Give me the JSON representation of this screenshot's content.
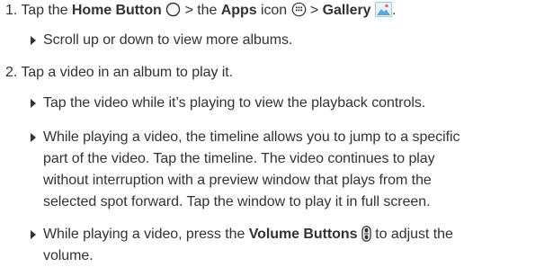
{
  "steps": [
    {
      "num": "1.",
      "parts": {
        "t1": "Tap the ",
        "home_button": "Home Button",
        "t2": " > the ",
        "apps": "Apps",
        "t3": " icon ",
        "t4": " > ",
        "gallery": "Gallery",
        "t5": "."
      },
      "icons": [
        "home-circle-icon",
        "apps-grid-icon",
        "gallery-icon"
      ],
      "bullets": [
        {
          "lines": [
            "Scroll up or down to view more albums."
          ]
        }
      ]
    },
    {
      "num": "2.",
      "text": "Tap a video in an album to play it.",
      "bullets": [
        {
          "lines": [
            "Tap the video while it’s playing to view the playback controls."
          ]
        },
        {
          "lines": [
            "While playing a video, the timeline allows you to jump to a specific",
            "part of the video. Tap the timeline. The video continues to play",
            "without interruption with a preview window that plays from the",
            "selected spot forward. Tap the window to play it in full screen."
          ]
        },
        {
          "pre": "While playing a video, press the ",
          "bold": "Volume Buttons",
          "post": " to adjust the",
          "line2": "volume.",
          "icon": "volume-buttons-icon"
        }
      ]
    }
  ],
  "colors": {
    "text": "#333333",
    "gallery_icon": "#5aa7d6"
  }
}
